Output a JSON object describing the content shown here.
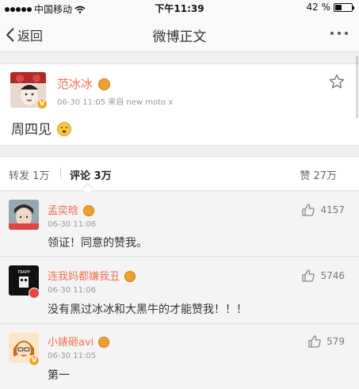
{
  "status_bar": {
    "carrier": "中国移动",
    "time": "下午11:39",
    "battery": "42 %",
    "battery_level": 0.42
  },
  "nav": {
    "back_label": "返回",
    "title": "微博正文"
  },
  "post": {
    "author": "范冰冰",
    "time": "06-30 11:05",
    "source": "来自 new moto x",
    "text": "周四见"
  },
  "tabs": {
    "repost": "转发 1万",
    "comment": "评论 3万",
    "like": "赞 27万"
  },
  "comments": [
    {
      "name": "孟奕晗",
      "time": "06-30 11:06",
      "text": "领证！同意的赞我。",
      "likes": "4157"
    },
    {
      "name": "连我妈都嫌我丑",
      "time": "06-30 11:06",
      "text": "没有黑过冰冰和大黑牛的才能赞我！！！",
      "likes": "5746"
    },
    {
      "name": "小婊砸avi",
      "time": "06-30 11:05",
      "text": "第一",
      "likes": "579"
    }
  ],
  "colors": {
    "accent": "#eb7350",
    "verified": "#f5a623",
    "background": "#f0f0f0"
  }
}
